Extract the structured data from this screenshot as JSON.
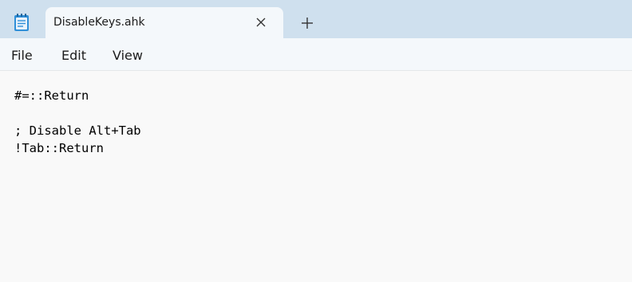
{
  "tab": {
    "title": "DisableKeys.ahk",
    "close_symbol": "✕",
    "new_tab_symbol": "+"
  },
  "menu": {
    "file": "File",
    "edit": "Edit",
    "view": "View"
  },
  "editor": {
    "lines": [
      "#=::Return",
      "",
      "; Disable Alt+Tab",
      "!Tab::Return"
    ]
  },
  "icons": {
    "app": "notepad-icon",
    "close": "close-icon",
    "add": "plus-icon"
  },
  "colors": {
    "titlebar": "#cfe0ee",
    "tab": "#f4f8fb",
    "editor": "#f9f9f9"
  }
}
